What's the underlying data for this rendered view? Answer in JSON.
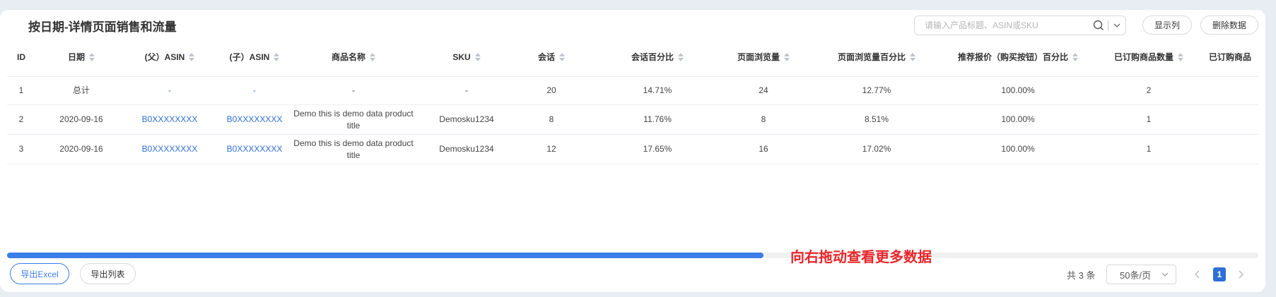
{
  "header": {
    "title": "按日期-详情页面销售和流量",
    "search_placeholder": "请输入产品标题、ASIN或SKU",
    "show_columns": "显示列",
    "delete_data": "删除数据"
  },
  "table": {
    "columns": {
      "id": "ID",
      "date": "日期",
      "parent_asin": "(父）ASIN",
      "child_asin": "(子）ASIN",
      "product_name": "商品名称",
      "sku": "SKU",
      "sessions": "会话",
      "session_pct": "会话百分比",
      "page_views": "页面浏览量",
      "page_view_pct": "页面浏览量百分比",
      "buybox_pct": "推荐报价（购买按钮）百分比",
      "units_ordered": "已订购商品数量",
      "units_ordered_2": "已订购商品"
    },
    "total_row": {
      "id": "1",
      "date": "总计",
      "parent_asin": "-",
      "child_asin": "-",
      "product_name": "-",
      "sku": "-",
      "sessions": "20",
      "session_pct": "14.71%",
      "page_views": "24",
      "page_view_pct": "12.77%",
      "buybox_pct": "100.00%",
      "units_ordered": "2"
    },
    "rows": [
      {
        "id": "2",
        "date": "2020-09-16",
        "parent_asin": "B0XXXXXXXX",
        "child_asin": "B0XXXXXXXX",
        "product_name": "Demo this is demo data product title",
        "sku": "Demosku1234",
        "sessions": "8",
        "session_pct": "11.76%",
        "page_views": "8",
        "page_view_pct": "8.51%",
        "buybox_pct": "100.00%",
        "units_ordered": "1"
      },
      {
        "id": "3",
        "date": "2020-09-16",
        "parent_asin": "B0XXXXXXXX",
        "child_asin": "B0XXXXXXXX",
        "product_name": "Demo this is demo data product title",
        "sku": "Demosku1234",
        "sessions": "12",
        "session_pct": "17.65%",
        "page_views": "16",
        "page_view_pct": "17.02%",
        "buybox_pct": "100.00%",
        "units_ordered": "1"
      }
    ]
  },
  "scroll_hint": "向右拖动查看更多数据",
  "footer": {
    "export_excel": "导出Excel",
    "export_list": "导出列表",
    "total": "共 3 条",
    "page_size": "50条/页",
    "current_page": "1"
  },
  "colors": {
    "accent": "#3b7ee8",
    "link": "#2f6fd6",
    "hint_red": "#e8262a"
  },
  "icons": {
    "search": "search-icon",
    "dropdown": "chevron-down-icon",
    "sort": "sort-icon",
    "prev": "chevron-left-icon",
    "next": "chevron-right-icon"
  }
}
